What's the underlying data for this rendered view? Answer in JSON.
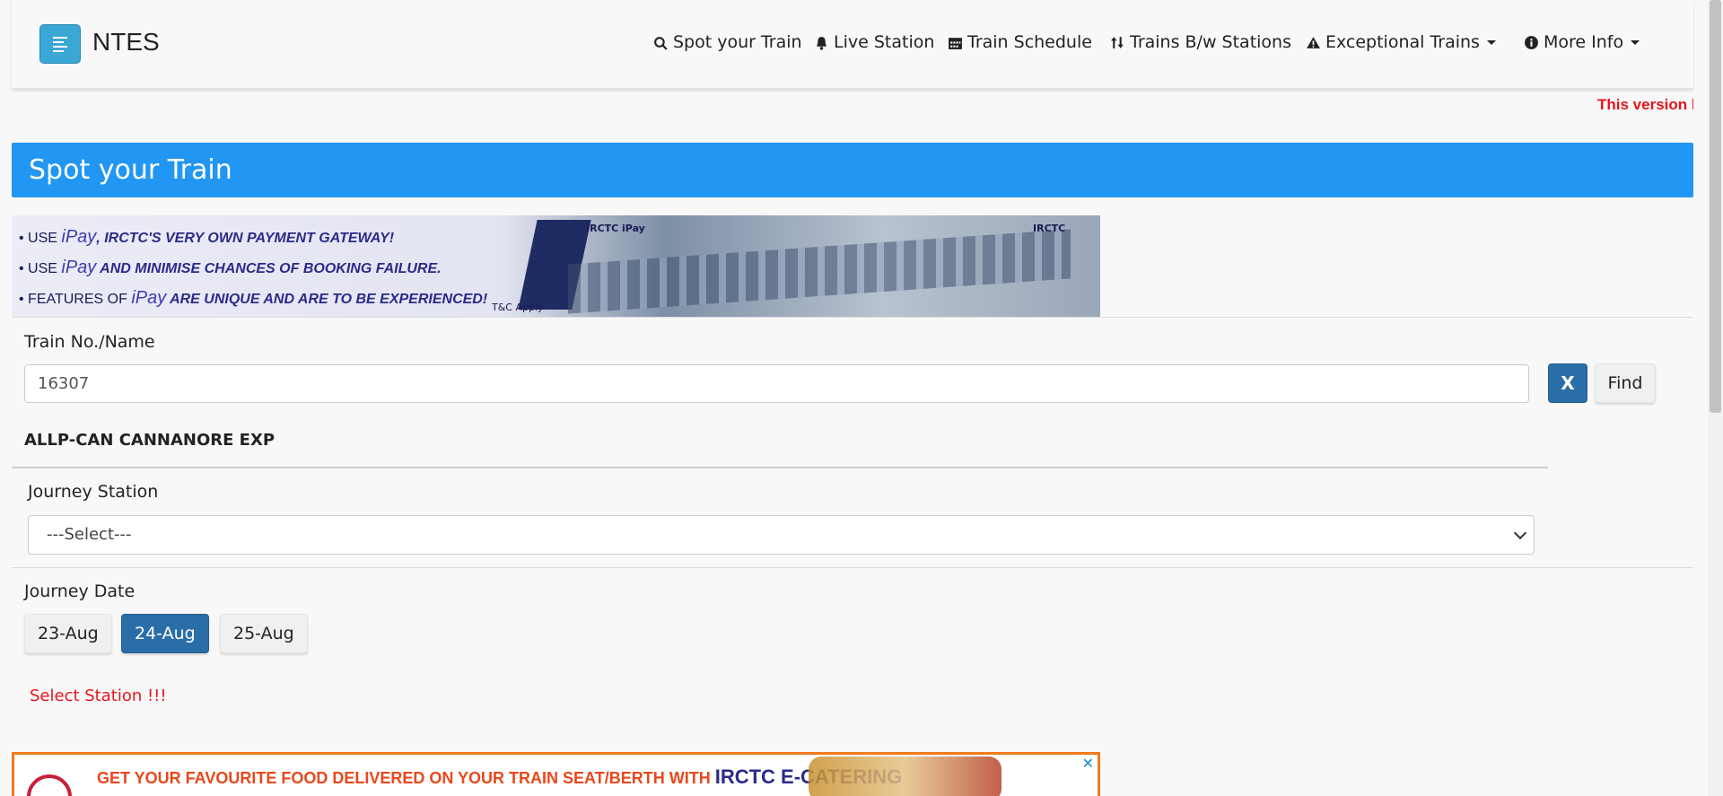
{
  "navbar": {
    "brand": "NTES",
    "items": [
      {
        "label": "Spot your Train",
        "icon": "search-icon"
      },
      {
        "label": "Live Station",
        "icon": "bell-icon"
      },
      {
        "label": "Train Schedule",
        "icon": "calendar-icon"
      },
      {
        "label": "Trains B/w Stations",
        "icon": "sort-arrows-icon"
      },
      {
        "label": "Exceptional Trains",
        "icon": "warning-icon",
        "dropdown": true
      },
      {
        "label": "More Info",
        "icon": "info-icon",
        "dropdown": true
      }
    ]
  },
  "notice": "This version ha",
  "page": {
    "title": "Spot your Train"
  },
  "banner": {
    "line1_a": "• USE ",
    "line1_ipay": "iPay",
    "line1_b": ", IRCTC'S VERY OWN PAYMENT GATEWAY!",
    "line2_a": "• USE ",
    "line2_ipay": "iPay",
    "line2_b": " AND MINIMISE CHANCES OF BOOKING FAILURE.",
    "line3_a": "• FEATURES OF ",
    "line3_ipay": "iPay",
    "line3_b": " ARE UNIQUE AND ARE TO BE EXPERIENCED!",
    "tc": "T&C Apply",
    "logo_left": "IRCTC iPay",
    "logo_right": "IRCTC"
  },
  "form": {
    "train_label": "Train No./Name",
    "train_value": "16307",
    "clear_label": "X",
    "find_label": "Find",
    "train_name": "ALLP-CAN CANNANORE EXP",
    "station_label": "Journey Station",
    "station_selected": "---Select---",
    "date_label": "Journey Date",
    "dates": [
      "23-Aug",
      "24-Aug",
      "25-Aug"
    ],
    "active_date": "24-Aug",
    "error": "Select Station !!!"
  },
  "food_banner": {
    "text_a": "GET YOUR FAVOURITE FOOD DELIVERED ON YOUR TRAIN SEAT/BERTH WITH ",
    "text_b": "IRCTC E-CATERING"
  },
  "colors": {
    "primary": "#2196f3",
    "active_button": "#2a6ea8",
    "error": "#e8141c"
  }
}
